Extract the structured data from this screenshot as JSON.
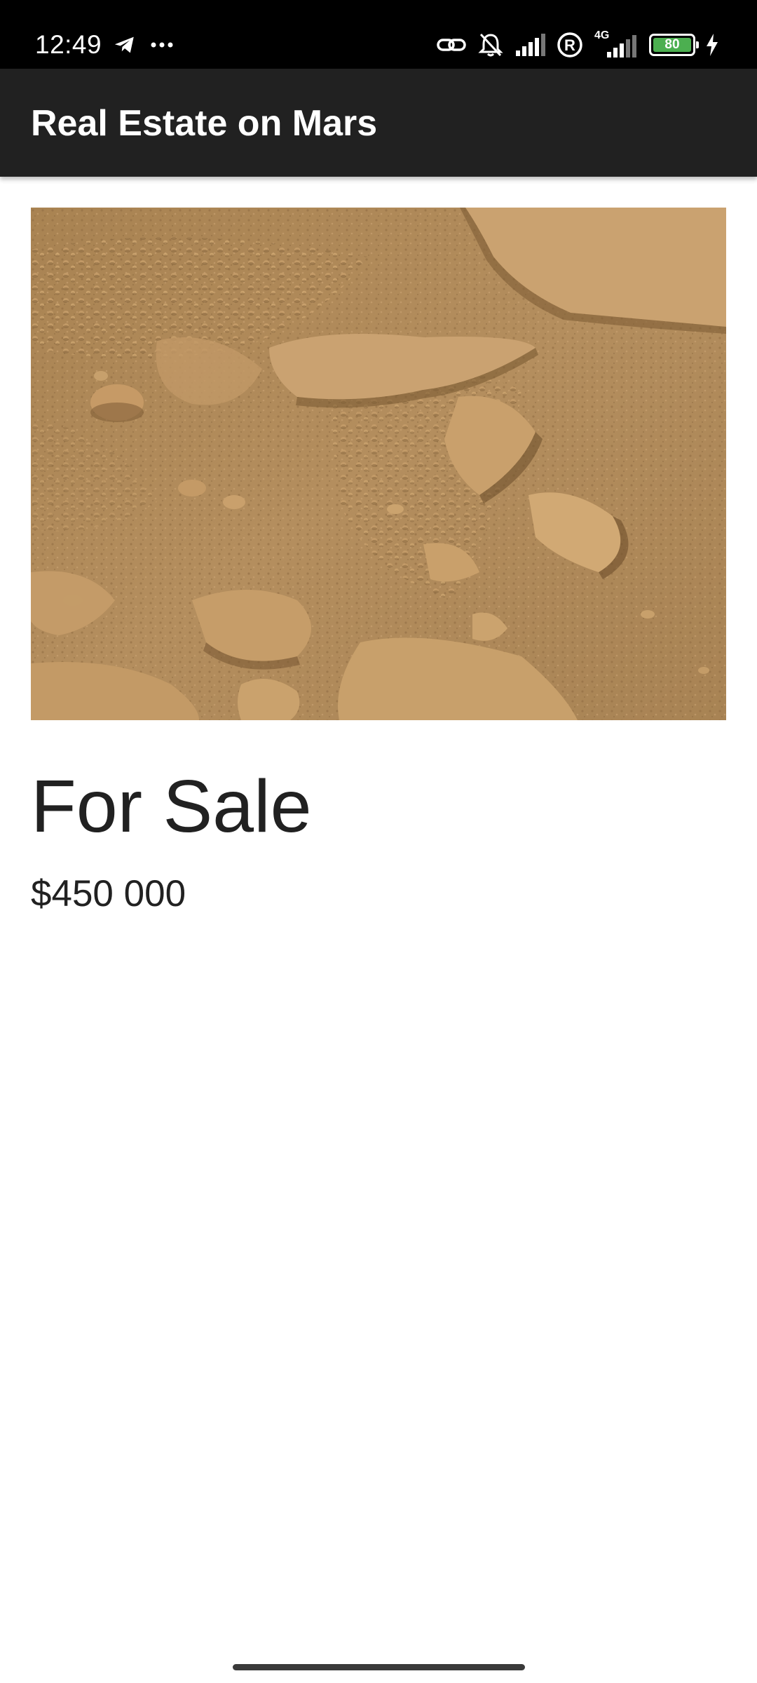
{
  "status_bar": {
    "time": "12:49",
    "network_label": "4G",
    "battery_level": "80",
    "icons": [
      "telegram-icon",
      "more-dots-icon",
      "link-icon",
      "muted-bell-icon",
      "signal-icon",
      "registered-icon",
      "signal-4g-icon",
      "battery-icon",
      "charging-icon"
    ]
  },
  "app_bar": {
    "title": "Real Estate on Mars"
  },
  "listing": {
    "image_alt": "Mars surface",
    "type": "For Sale",
    "price": "$450 000"
  },
  "colors": {
    "app_bar": "#212121",
    "status_bar": "#000000",
    "battery_fill": "#4caf50",
    "text_primary": "#212121"
  }
}
